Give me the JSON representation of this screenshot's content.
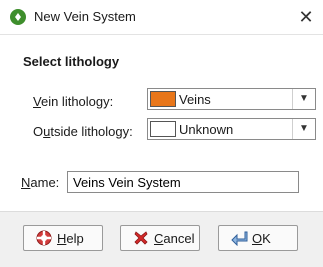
{
  "window": {
    "title": "New Vein System",
    "close_glyph": "✕",
    "icon": "app-logo-icon",
    "icon_color": "#3e8e2c"
  },
  "section": {
    "heading": "Select lithology"
  },
  "vein_lithology": {
    "label_mnemonic": "V",
    "label_rest": "ein lithology:",
    "value": "Veins",
    "swatch_color": "#e8761a"
  },
  "outside_lithology": {
    "label_pre": "O",
    "label_mnemonic": "u",
    "label_rest": "tside lithology:",
    "value": "Unknown",
    "swatch_color": "#ffffff"
  },
  "name_field": {
    "label_mnemonic": "N",
    "label_rest": "ame:",
    "value": "Veins Vein System"
  },
  "buttons": {
    "help": {
      "mnemonic": "H",
      "rest": "elp",
      "icon": "lifebuoy-icon"
    },
    "cancel": {
      "mnemonic": "C",
      "rest": "ancel",
      "icon": "red-x-icon"
    },
    "ok": {
      "mnemonic": "O",
      "rest": "K",
      "icon": "return-arrow-icon"
    }
  },
  "dropdown_glyph": "▼"
}
